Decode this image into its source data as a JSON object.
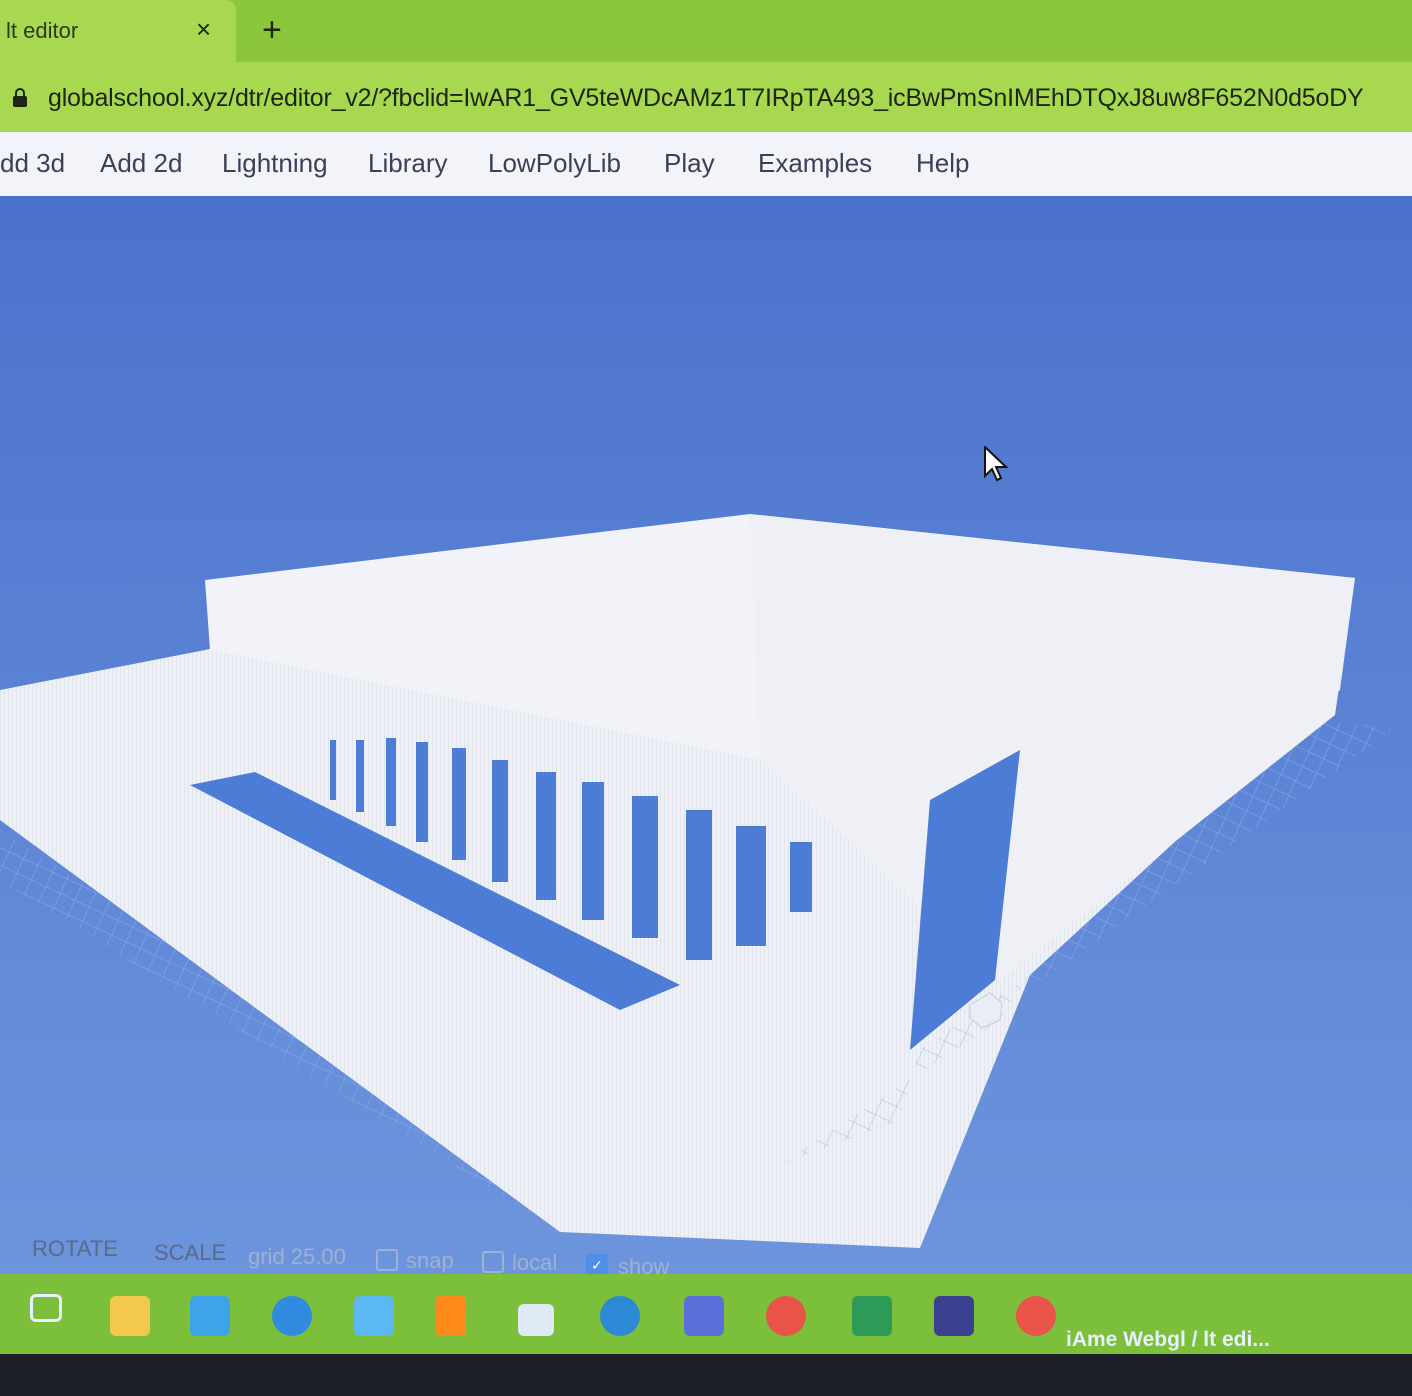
{
  "browser": {
    "tab_title": "lt editor",
    "tab_close_symbol": "×",
    "new_tab_symbol": "+",
    "url": "globalschool.xyz/dtr/editor_v2/?fbclid=IwAR1_GV5teWDcAMz1T7IRpTA493_icBwPmSnIMEhDTQxJ8uw8F652N0d5oDY"
  },
  "menu": {
    "items": [
      {
        "label": "dd 3d"
      },
      {
        "label": "Add 2d"
      },
      {
        "label": "Lightning"
      },
      {
        "label": "Library"
      },
      {
        "label": "LowPolyLib"
      },
      {
        "label": "Play"
      },
      {
        "label": "Examples"
      },
      {
        "label": "Help"
      }
    ]
  },
  "tools": {
    "rotate": "ROTATE",
    "scale": "SCALE",
    "grid": "grid 25.00",
    "snap": "snap",
    "local": "local",
    "show": "show",
    "snap_checked": false,
    "local_checked": false,
    "show_checked": true
  },
  "taskbar": {
    "icons": [
      "task-view-icon",
      "file-explorer-icon",
      "store-icon",
      "photos-icon",
      "mail-icon",
      "vlc-icon",
      "app-icon",
      "edge-icon",
      "teams-icon",
      "chrome-icon",
      "excel-icon",
      "app-icon-2",
      "chrome-window-icon"
    ],
    "active_window_label": "iAme Webgl / lt edi..."
  },
  "colors": {
    "viewport_bg": "#4f79cf",
    "tab_green": "#a8d84f",
    "taskbar_green": "#7cbf3a"
  }
}
